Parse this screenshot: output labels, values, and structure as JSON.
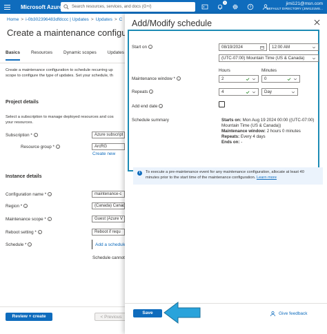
{
  "topbar": {
    "brand": "Microsoft Azure",
    "search_placeholder": "Search resources, services, and docs (G+/)",
    "notification_count": "1",
    "account_email": "jimi121@msn.com",
    "account_directory": "DEFAULT DIRECTORY (JIMI121MS..."
  },
  "breadcrumb": [
    "Home",
    "i-0b302396483dfdccc | Updates",
    "Updates",
    "C"
  ],
  "page": {
    "title": "Create a maintenance configura",
    "tabs": [
      "Basics",
      "Resources",
      "Dynamic scopes",
      "Updates"
    ],
    "description_lines": [
      "Create a maintenance configuration to schedule recurring up",
      "scope to configure the type of updates. Set your schedule, th"
    ],
    "project_details": {
      "heading": "Project details",
      "desc_lines": [
        "Select a subscription to manage deployed resources and cos",
        "your resources."
      ],
      "subscription_label": "Subscription *",
      "subscription_value": "Azure subscript",
      "resource_group_label": "Resource group *",
      "resource_group_value": "ArcRG",
      "create_new": "Create new"
    },
    "instance_details": {
      "heading": "Instance details",
      "configuration_name_label": "Configuration name *",
      "configuration_name_value": "maintenance-c",
      "region_label": "Region *",
      "region_value": "(Canada) Canad",
      "maintenance_scope_label": "Maintenance scope *",
      "maintenance_scope_value": "Guest (Azure V",
      "reboot_setting_label": "Reboot setting *",
      "reboot_setting_value": "Reboot if requ",
      "schedule_label": "Schedule *",
      "add_schedule": "Add a schedule",
      "schedule_cannot": "Schedule cannot"
    },
    "review_create": "Review + create",
    "previous": "< Previous"
  },
  "panel": {
    "title": "Add/Modify schedule",
    "start_on_label": "Start on",
    "start_date": "08/19/2024",
    "start_time": "12:00 AM",
    "timezone": "(UTC-07:00) Mountain Time (US & Canada)",
    "hours_label": "Hours",
    "minutes_label": "Minutes",
    "maintenance_window_label": "Maintenance window *",
    "hours_value": "2",
    "minutes_value": "0",
    "repeats_label": "Repeats",
    "repeats_value": "4",
    "repeats_unit": "Day",
    "add_end_date_label": "Add end date",
    "schedule_summary_label": "Schedule summary",
    "summary": {
      "starts_on_label": "Starts on:",
      "starts_on_value": "Mon Aug 19 2024 00:00 ((UTC-07:00)",
      "starts_on_cont": "Mountain Time (US & Canada))",
      "window_label": "Maintenance window:",
      "window_value": "2 hours 0 minutes",
      "repeats_label": "Repeats:",
      "repeats_value": "Every 4 days",
      "ends_label": "Ends on:",
      "ends_value": "-"
    },
    "info_text_1": "To execute a pre-maintenance event for any maintenance configuration, allocate at least 40",
    "info_text_2": "minutes prior to the start time of the maintenance configuration.",
    "learn_more": "Learn more",
    "save": "Save",
    "give_feedback": "Give feedback"
  },
  "colors": {
    "azure_blue": "#0f6cbd",
    "highlight": "#1b8ab4",
    "arrow": "#29a3db"
  }
}
